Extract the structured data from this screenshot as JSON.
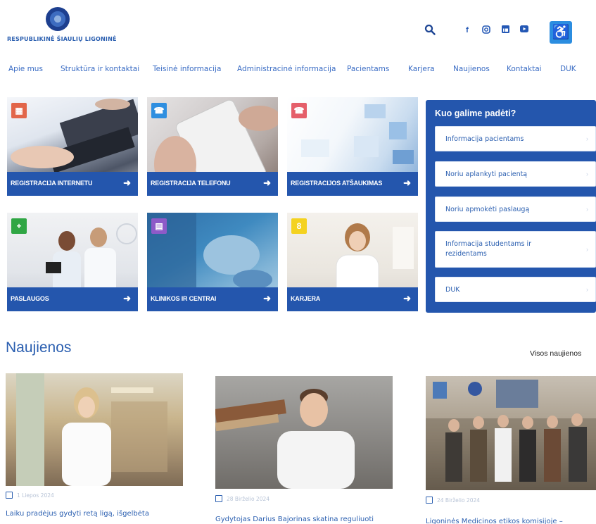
{
  "header": {
    "logo_text": "RESPUBLIKINĖ ŠIAULIŲ LIGONINĖ",
    "social": [
      "facebook-icon",
      "instagram-icon",
      "linkedin-icon",
      "youtube-icon"
    ],
    "accessibility_icon": "♿"
  },
  "nav": {
    "items": [
      "Apie mus",
      "Struktūra ir kontaktai",
      "Teisinė informacija",
      "Administracinė informacija",
      "Pacientams",
      "Karjera",
      "Naujienos",
      "Kontaktai",
      "DUK"
    ]
  },
  "tiles": [
    {
      "label": "REGISTRACIJA INTERNETU",
      "badge": "▦",
      "badge_color": "#e2664a"
    },
    {
      "label": "REGISTRACIJA TELEFONU",
      "badge": "☎",
      "badge_color": "#2f8fe0"
    },
    {
      "label": "REGISTRACIJOS ATŠAUKIMAS",
      "badge": "☎",
      "badge_color": "#e55f6a"
    },
    {
      "label": "PASLAUGOS",
      "badge": "+",
      "badge_color": "#2fa644"
    },
    {
      "label": "KLINIKOS IR CENTRAI",
      "badge": "▤",
      "badge_color": "#8e5ac8"
    },
    {
      "label": "KARJERA",
      "badge": "8",
      "badge_color": "#f4d21f"
    }
  ],
  "help": {
    "title": "Kuo galime padėti?",
    "items": [
      "Informacija pacientams",
      "Noriu aplankyti pacientą",
      "Noriu apmokėti paslaugą",
      "Informacija studentams ir rezidentams",
      "DUK"
    ]
  },
  "news": {
    "title": "Naujienos",
    "all_label": "Visos naujienos",
    "cards": [
      {
        "date": "1 Liepos 2024",
        "headline": "Laiku pradėjus gydyti retą ligą, išgelbėta"
      },
      {
        "date": "28 Birželio 2024",
        "headline": "Gydytojas Darius Bajorinas skatina reguliuoti"
      },
      {
        "date": "24 Birželio 2024",
        "headline": "Ligoninės Medicinos etikos komisijoje –"
      }
    ]
  },
  "colors": {
    "brand": "#2456ad",
    "link": "#2b5fb0",
    "access": "#2b8de0"
  }
}
